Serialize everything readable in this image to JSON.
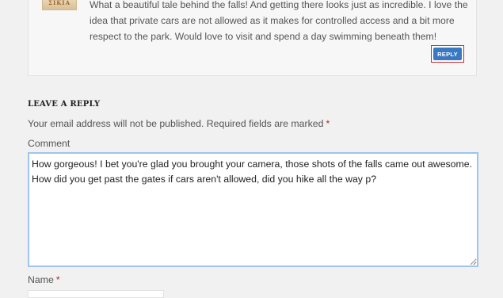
{
  "comment": {
    "avatar_text": "ΣΙΚΙΑ",
    "text": "What a beautiful tale behind the falls! And getting there looks just as incredible. I love the idea that private cars are not allowed as it makes for controlled access and a bit more respect to the park. Would love to visit and spend a day swimming beneath them!",
    "reply_label": "REPLY"
  },
  "reply_form": {
    "heading": "LEAVE A REPLY",
    "notes": "Your email address will not be published. Required fields are marked",
    "required_mark": "*",
    "comment_label": "Comment",
    "comment_value": "How gorgeous! I bet you're glad you brought your camera, those shots of the falls came out awesome. How did you get past the gates if cars aren't allowed, did you hike all the way p?",
    "name_label": "Name",
    "name_value": ""
  },
  "colors": {
    "reply_button": "#3978c2",
    "reply_button_border": "#c7272c",
    "focus_border": "#9ec4ef",
    "required": "#bb2222"
  }
}
